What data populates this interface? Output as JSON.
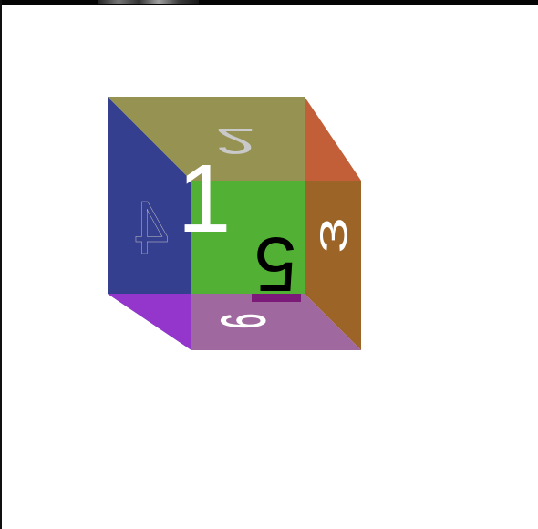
{
  "scene": {
    "faces": {
      "front": {
        "label": "1",
        "color": "#52b034",
        "text_color": "#ffffff"
      },
      "top": {
        "label": "2",
        "color": "#969252",
        "text_color": "#c9c9c9"
      },
      "right": {
        "label": "3",
        "color": "#9d6427",
        "text_color": "#ffffff"
      },
      "left": {
        "label": "4",
        "color": "#353f90",
        "text_color": "#c4c4c4"
      },
      "back": {
        "label": "5",
        "color": "#c35f38",
        "text_color": "#000000"
      },
      "bottom": {
        "label": "6",
        "color": "#9f699f",
        "text_color": "#ffffff"
      }
    },
    "accent_colors": {
      "bottom_left_edge": "#9436cc",
      "back_bottom_strip": "#7b1a78"
    }
  }
}
